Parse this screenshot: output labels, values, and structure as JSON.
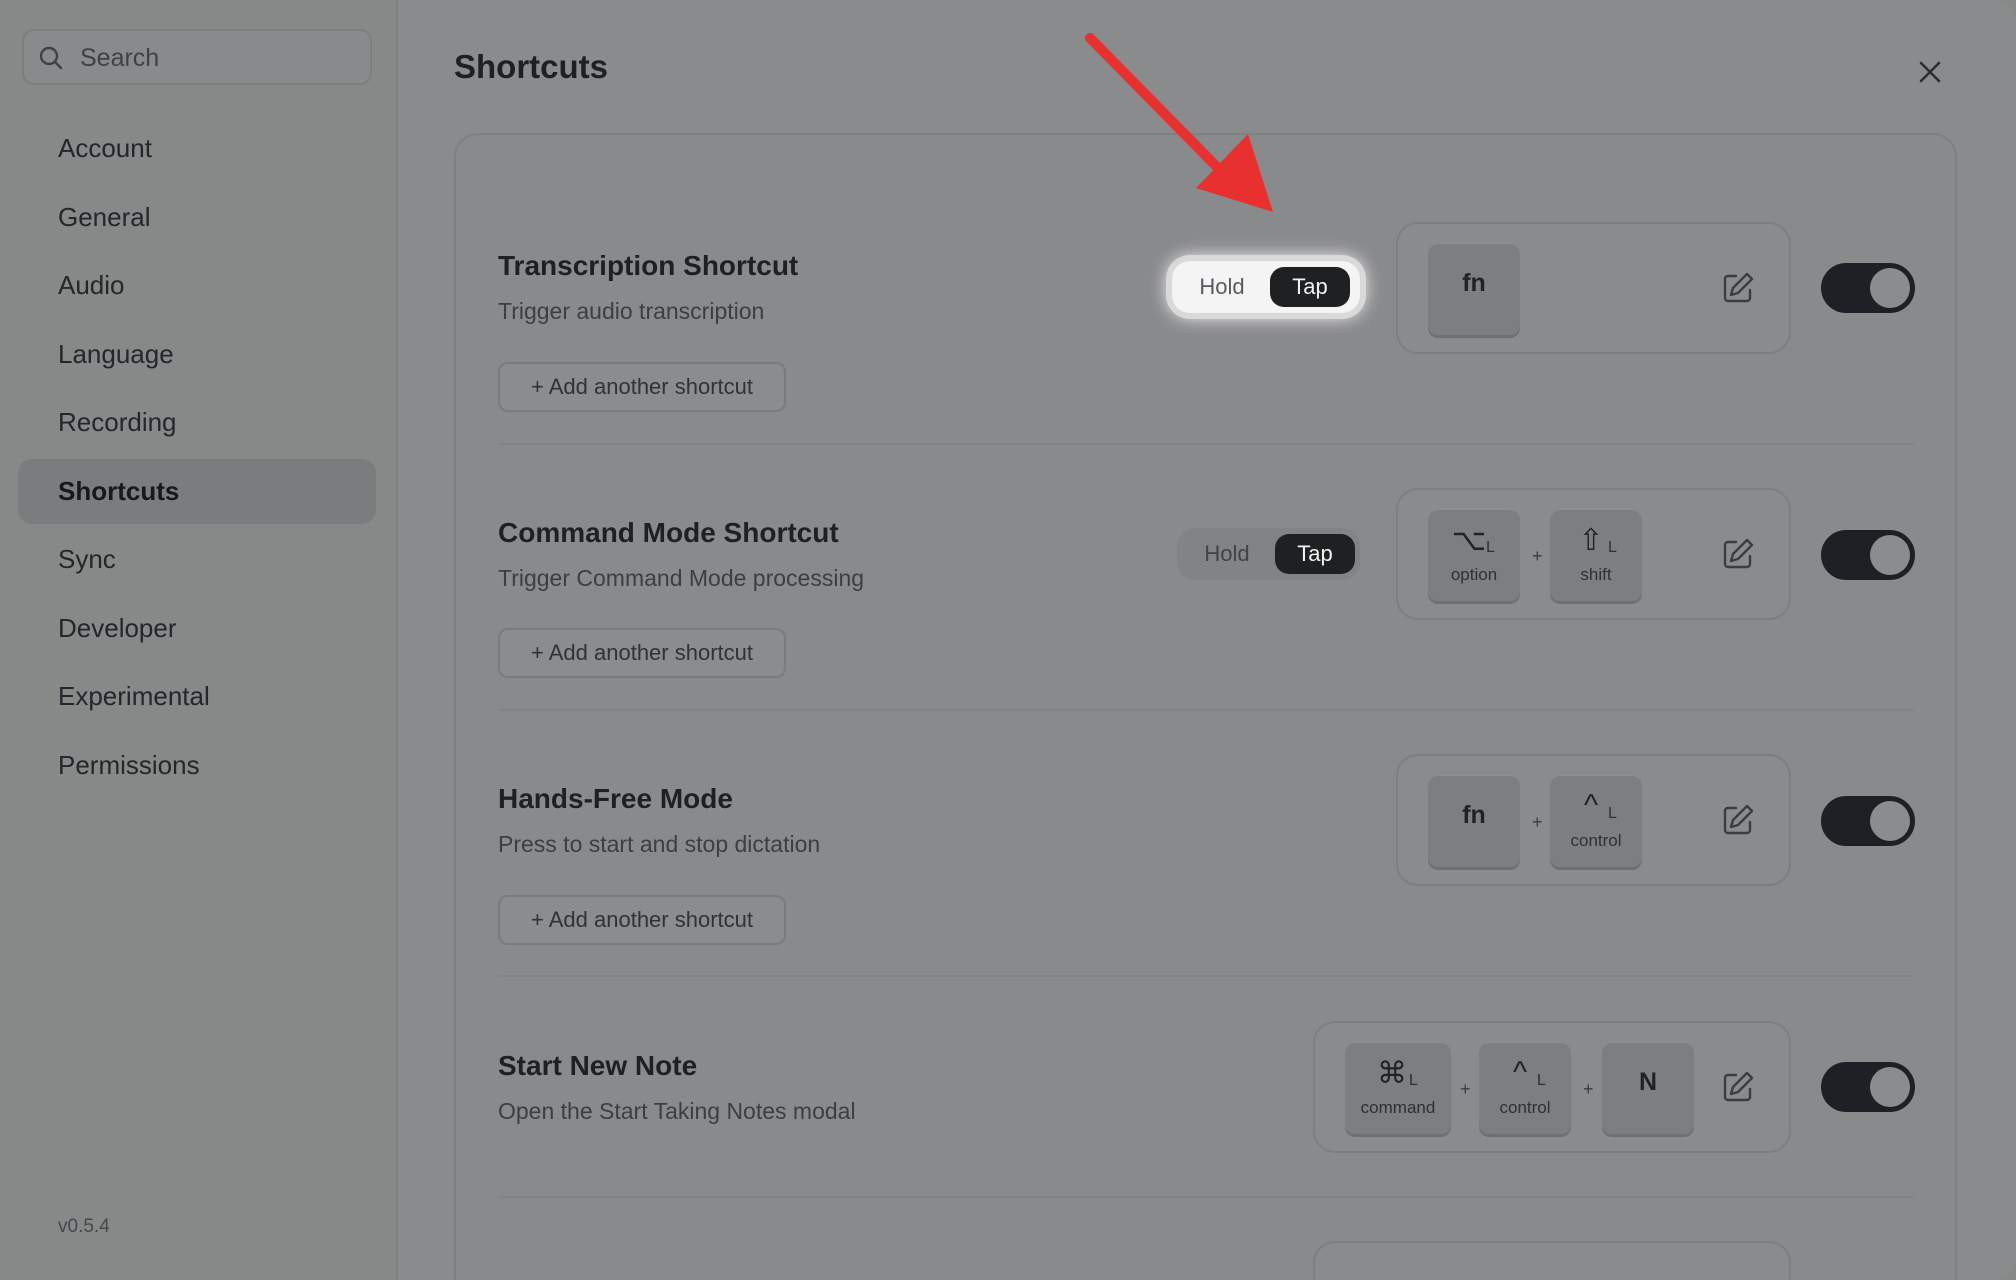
{
  "sidebar": {
    "search_placeholder": "Search",
    "items": [
      {
        "label": "Account"
      },
      {
        "label": "General"
      },
      {
        "label": "Audio"
      },
      {
        "label": "Language"
      },
      {
        "label": "Recording"
      },
      {
        "label": "Shortcuts",
        "active": true
      },
      {
        "label": "Sync"
      },
      {
        "label": "Developer"
      },
      {
        "label": "Experimental"
      },
      {
        "label": "Permissions"
      }
    ],
    "version": "v0.5.4"
  },
  "page": {
    "title": "Shortcuts"
  },
  "rows": [
    {
      "title": "Transcription Shortcut",
      "subtitle": "Trigger audio transcription",
      "add_label": "+ Add another shortcut",
      "mode": {
        "hold": "Hold",
        "tap": "Tap",
        "selected": "Tap"
      },
      "keys": [
        {
          "main": "fn"
        }
      ],
      "enabled": true
    },
    {
      "title": "Command Mode Shortcut",
      "subtitle": "Trigger Command Mode processing",
      "add_label": "+ Add another shortcut",
      "mode": {
        "hold": "Hold",
        "tap": "Tap",
        "selected": "Tap"
      },
      "keys": [
        {
          "symbol": "⌥",
          "side": "L",
          "label": "option"
        },
        {
          "symbol": "⇧",
          "side": "L",
          "label": "shift"
        }
      ],
      "enabled": true
    },
    {
      "title": "Hands-Free Mode",
      "subtitle": "Press to start and stop dictation",
      "add_label": "+ Add another shortcut",
      "keys": [
        {
          "main": "fn"
        },
        {
          "symbol": "^",
          "side": "L",
          "label": "control"
        }
      ],
      "enabled": true
    },
    {
      "title": "Start New Note",
      "subtitle": "Open the Start Taking Notes modal",
      "keys": [
        {
          "symbol": "⌘",
          "side": "L",
          "label": "command"
        },
        {
          "symbol": "^",
          "side": "L",
          "label": "control"
        },
        {
          "main": "N"
        }
      ],
      "enabled": true
    }
  ],
  "plus_sign": "+",
  "annotation": {
    "color": "#e8302f"
  }
}
